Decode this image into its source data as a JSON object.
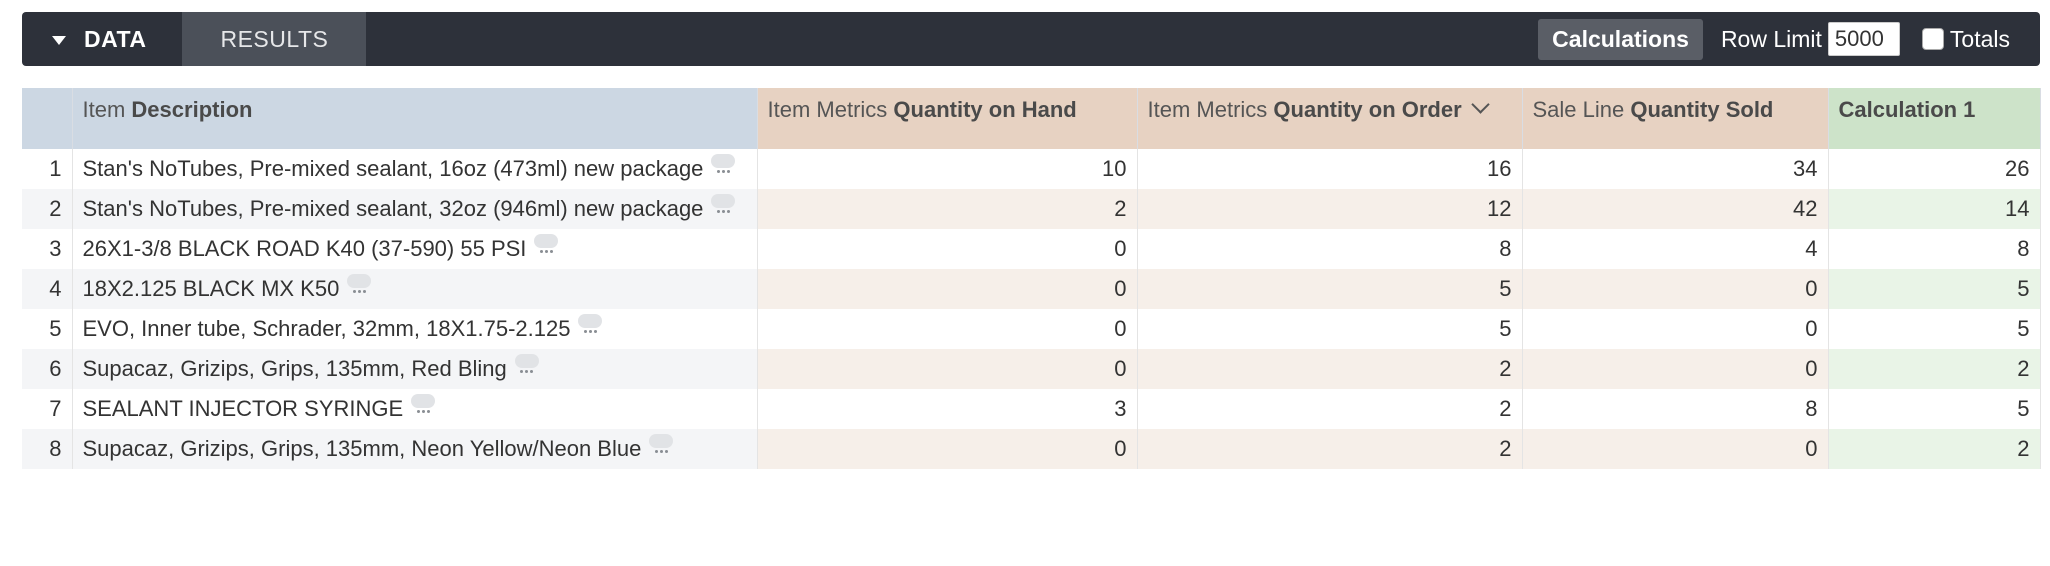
{
  "toolbar": {
    "data_tab": "DATA",
    "results_tab": "RESULTS",
    "calculations_button": "Calculations",
    "row_limit_label": "Row Limit",
    "row_limit_value": "5000",
    "totals_label": "Totals",
    "totals_checked": false
  },
  "table": {
    "columns": [
      {
        "prefix": "Item",
        "name": "Description"
      },
      {
        "prefix": "Item Metrics",
        "name": "Quantity on Hand"
      },
      {
        "prefix": "Item Metrics",
        "name": "Quantity on Order",
        "sorted": "descending"
      },
      {
        "prefix": "Sale Line",
        "name": "Quantity Sold"
      },
      {
        "prefix": "",
        "name": "Calculation 1"
      }
    ],
    "rows": [
      {
        "index": "1",
        "description": "Stan's NoTubes, Pre-mixed sealant, 16oz (473ml) new package",
        "on_hand": "10",
        "on_order": "16",
        "sold": "34",
        "calc": "26"
      },
      {
        "index": "2",
        "description": "Stan's NoTubes, Pre-mixed sealant, 32oz (946ml) new package",
        "on_hand": "2",
        "on_order": "12",
        "sold": "42",
        "calc": "14"
      },
      {
        "index": "3",
        "description": "26X1-3/8 BLACK ROAD K40 (37-590) 55 PSI",
        "on_hand": "0",
        "on_order": "8",
        "sold": "4",
        "calc": "8"
      },
      {
        "index": "4",
        "description": "18X2.125 BLACK MX K50",
        "on_hand": "0",
        "on_order": "5",
        "sold": "0",
        "calc": "5"
      },
      {
        "index": "5",
        "description": "EVO, Inner tube, Schrader, 32mm, 18X1.75-2.125",
        "on_hand": "0",
        "on_order": "5",
        "sold": "0",
        "calc": "5"
      },
      {
        "index": "6",
        "description": "Supacaz, Grizips, Grips, 135mm, Red Bling",
        "on_hand": "0",
        "on_order": "2",
        "sold": "0",
        "calc": "2"
      },
      {
        "index": "7",
        "description": "SEALANT INJECTOR SYRINGE",
        "on_hand": "3",
        "on_order": "2",
        "sold": "8",
        "calc": "5"
      },
      {
        "index": "8",
        "description": "Supacaz, Grizips, Grips, 135mm, Neon Yellow/Neon Blue",
        "on_hand": "0",
        "on_order": "2",
        "sold": "0",
        "calc": "2"
      }
    ]
  },
  "colors": {
    "toolbar_bg": "#2d313a",
    "dimension_header": "#ccd7e3",
    "measure_header": "#e7d2c2",
    "calculation_header": "#cde3c9"
  }
}
